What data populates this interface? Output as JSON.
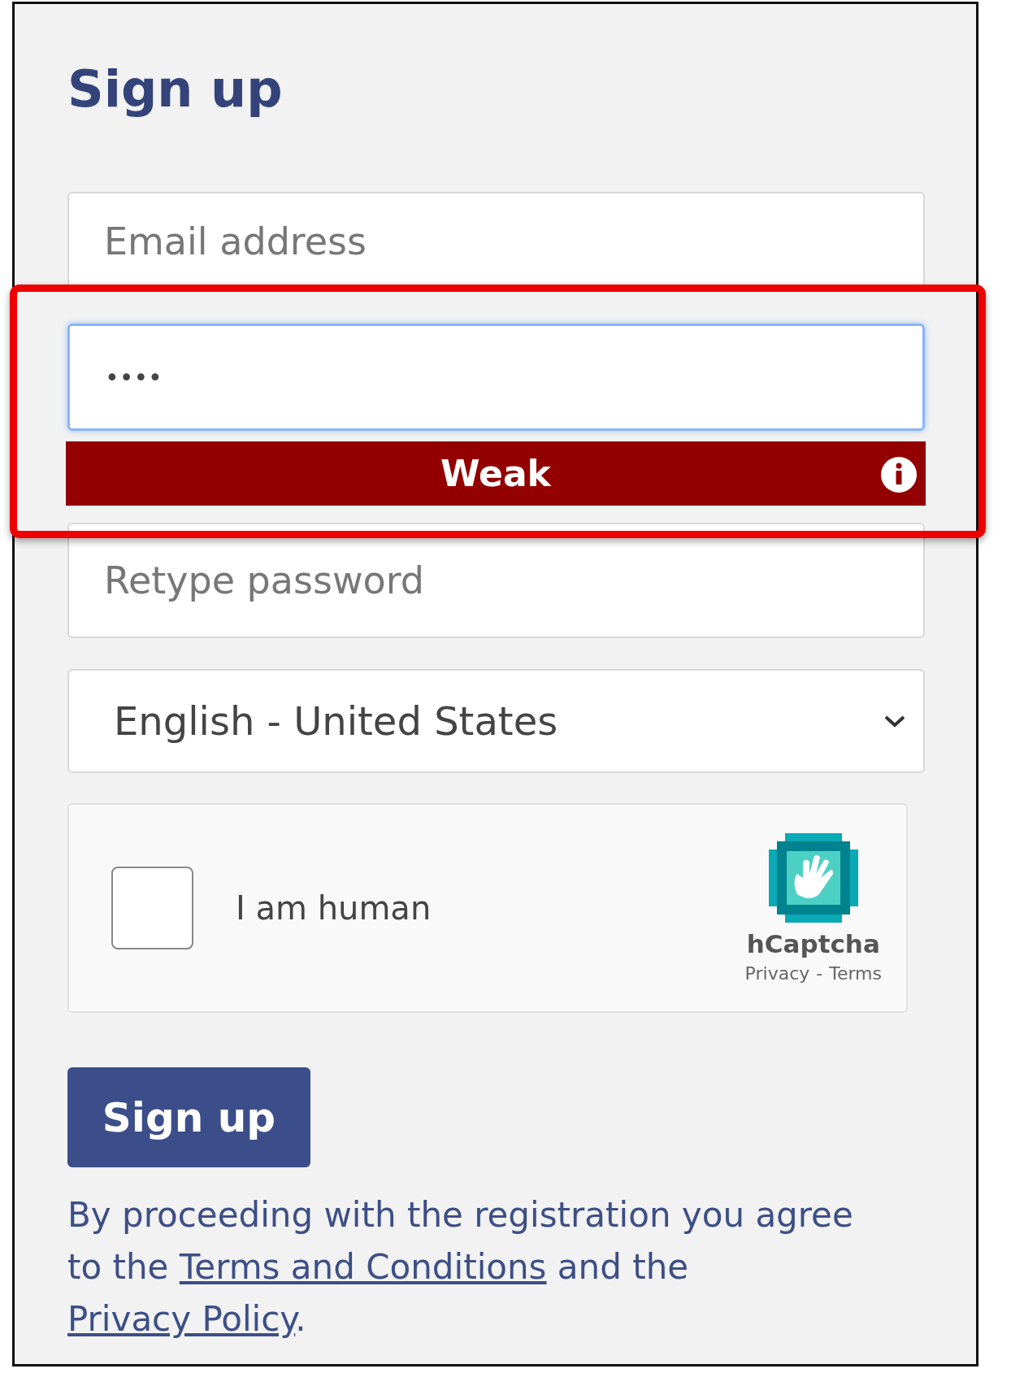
{
  "title": "Sign up",
  "email": {
    "placeholder": "Email address"
  },
  "password": {
    "value": "••••",
    "focused": true
  },
  "strength": {
    "label": "Weak"
  },
  "retype": {
    "placeholder": "Retype password"
  },
  "language": {
    "value": "English - United States"
  },
  "captcha": {
    "checked": false,
    "label": "I am human",
    "brand": "hCaptcha",
    "links": [
      "Privacy",
      "Terms"
    ],
    "separator": "-"
  },
  "button": "Sign up",
  "agreement": [
    {
      "kind": "text",
      "text": "By proceeding with the registration you agree to the "
    },
    {
      "kind": "link",
      "text": "Terms and Conditions"
    },
    {
      "kind": "text",
      "text": " and the "
    },
    {
      "kind": "link",
      "text": "Privacy Policy"
    },
    {
      "kind": "text",
      "text": "."
    }
  ]
}
